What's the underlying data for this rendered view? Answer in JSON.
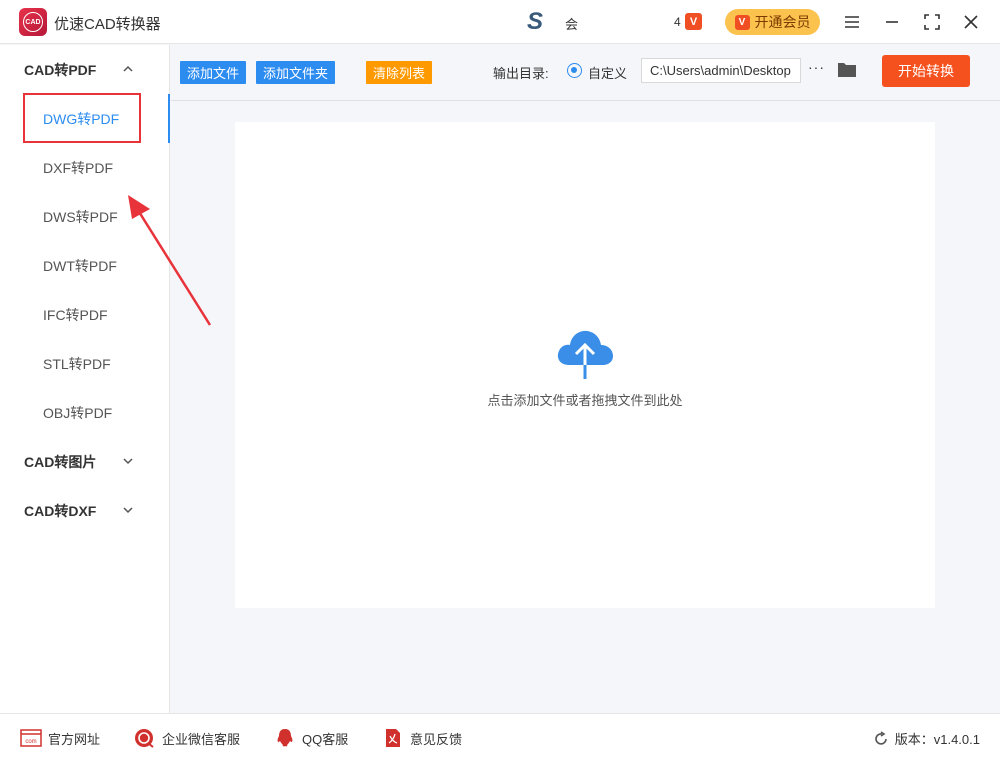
{
  "app": {
    "title": "优速CAD转换器",
    "logo_text": "CAD"
  },
  "titlebar": {
    "s_text": "会",
    "vip_count": "4",
    "vip_badge_text": "V",
    "vip_button_label": "开通会员"
  },
  "sidebar": {
    "groups": [
      {
        "label": "CAD转PDF",
        "expanded": true
      },
      {
        "label": "CAD转图片",
        "expanded": false
      },
      {
        "label": "CAD转DXF",
        "expanded": false
      }
    ],
    "items": [
      {
        "label": "DWG转PDF",
        "active": true
      },
      {
        "label": "DXF转PDF"
      },
      {
        "label": "DWS转PDF"
      },
      {
        "label": "DWT转PDF"
      },
      {
        "label": "IFC转PDF"
      },
      {
        "label": "STL转PDF"
      },
      {
        "label": "OBJ转PDF"
      }
    ]
  },
  "toolbar": {
    "add_file": "添加文件",
    "add_folder": "添加文件夹",
    "clear_list": "清除列表",
    "output_label": "输出目录:",
    "custom_label": "自定义",
    "output_path": "C:\\Users\\admin\\Desktop",
    "more": "···",
    "start": "开始转换"
  },
  "dropzone": {
    "hint": "点击添加文件或者拖拽文件到此处"
  },
  "footer": {
    "website": "官方网址",
    "wechat": "企业微信客服",
    "qq": "QQ客服",
    "feedback": "意见反馈",
    "version": "版本：v1.4.0.1"
  },
  "colors": {
    "primary": "#2d8cf0",
    "orange": "#ff9900",
    "start": "#f4511e",
    "highlight": "#e8333a"
  }
}
